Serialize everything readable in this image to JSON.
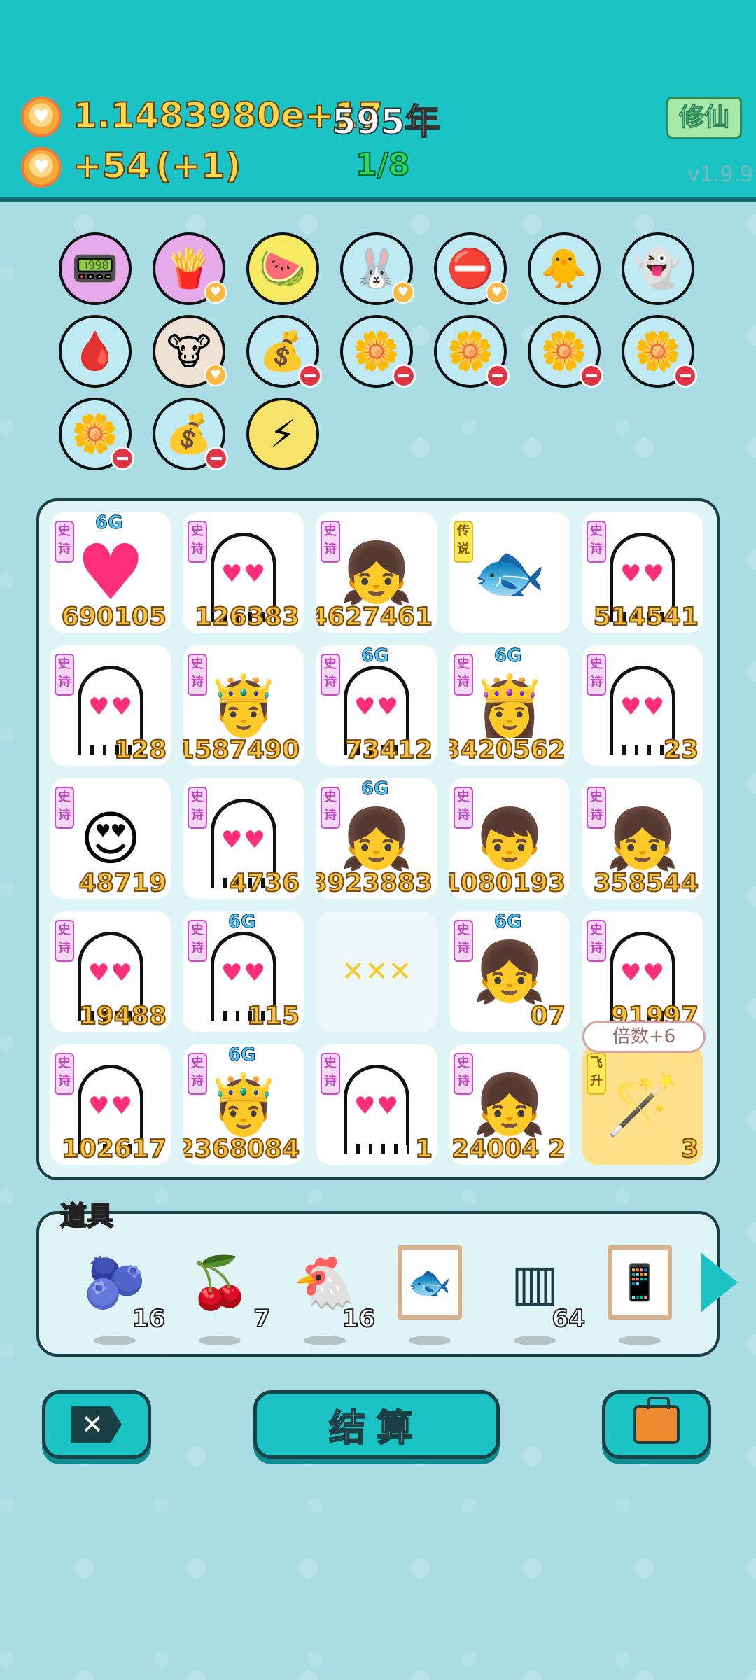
{
  "header": {
    "coins": "1.1483980e+17",
    "years": "595年",
    "income": "+54",
    "income_bonus": "(+1)",
    "progress": "1/8",
    "cultivate_button": "修仙",
    "version": "v1.9.9"
  },
  "buffs": [
    {
      "icon": "meter-icon",
      "glyph": "📟"
    },
    {
      "icon": "fries-icon",
      "glyph": "🍟"
    },
    {
      "icon": "fruit-basket-icon",
      "glyph": "🍉"
    },
    {
      "icon": "rabbit-icon",
      "glyph": "🐰"
    },
    {
      "icon": "no-entry-icon",
      "glyph": "⛔"
    },
    {
      "icon": "chick-icon",
      "glyph": "🐥"
    },
    {
      "icon": "ghost-icon",
      "glyph": "👻"
    },
    {
      "icon": "blood-bag-icon",
      "glyph": "🩸"
    },
    {
      "icon": "cows-icon",
      "glyph": "🐮"
    },
    {
      "icon": "sack-icon",
      "glyph": "💰"
    },
    {
      "icon": "flower-pot-icon",
      "glyph": "🌼"
    },
    {
      "icon": "flower-pot-icon",
      "glyph": "🌼"
    },
    {
      "icon": "flower-pot-icon",
      "glyph": "🌼"
    },
    {
      "icon": "flower-pot-icon",
      "glyph": "🌼"
    },
    {
      "icon": "flower-pot-icon",
      "glyph": "🌼"
    },
    {
      "icon": "sack-icon",
      "glyph": "💰"
    },
    {
      "icon": "lightning-icon",
      "glyph": "⚡"
    }
  ],
  "board": {
    "tag_epic": "史诗",
    "tag_legend": "传说",
    "tag_ascend": "飞升",
    "badge_6g": "6G",
    "multiplier_label": "倍数+6",
    "cells": [
      {
        "num": "690105"
      },
      {
        "num": "126383"
      },
      {
        "num": "4627461"
      },
      {
        "num": ""
      },
      {
        "num": "514541"
      },
      {
        "num": "128"
      },
      {
        "num": "1587490"
      },
      {
        "num": "73412"
      },
      {
        "num": "3420562"
      },
      {
        "num": "23"
      },
      {
        "num": "48719"
      },
      {
        "num": "4736"
      },
      {
        "num": "3923883"
      },
      {
        "num": "1080193"
      },
      {
        "num": "358544"
      },
      {
        "num": "19488"
      },
      {
        "num": "115"
      },
      {
        "num": ""
      },
      {
        "num": "07"
      },
      {
        "num": "91997"
      },
      {
        "num": "102617"
      },
      {
        "num": "2368084"
      },
      {
        "num": "1"
      },
      {
        "num": "24004 2"
      },
      {
        "num": "3"
      }
    ]
  },
  "items": {
    "title": "道具",
    "list": [
      {
        "name": "blueberry-icon",
        "glyph": "🫐",
        "count": "16"
      },
      {
        "name": "lychee-icon",
        "glyph": "🍒",
        "count": "7"
      },
      {
        "name": "chicken-icon",
        "glyph": "🐔",
        "count": "16"
      },
      {
        "name": "fish-frame-icon",
        "glyph": "🐟",
        "count": ""
      },
      {
        "name": "glass-panels-icon",
        "glyph": "▥",
        "count": "64"
      },
      {
        "name": "remote-frame-icon",
        "glyph": "📱",
        "count": ""
      }
    ]
  },
  "footer": {
    "exit": "✕",
    "settle": "结算"
  }
}
